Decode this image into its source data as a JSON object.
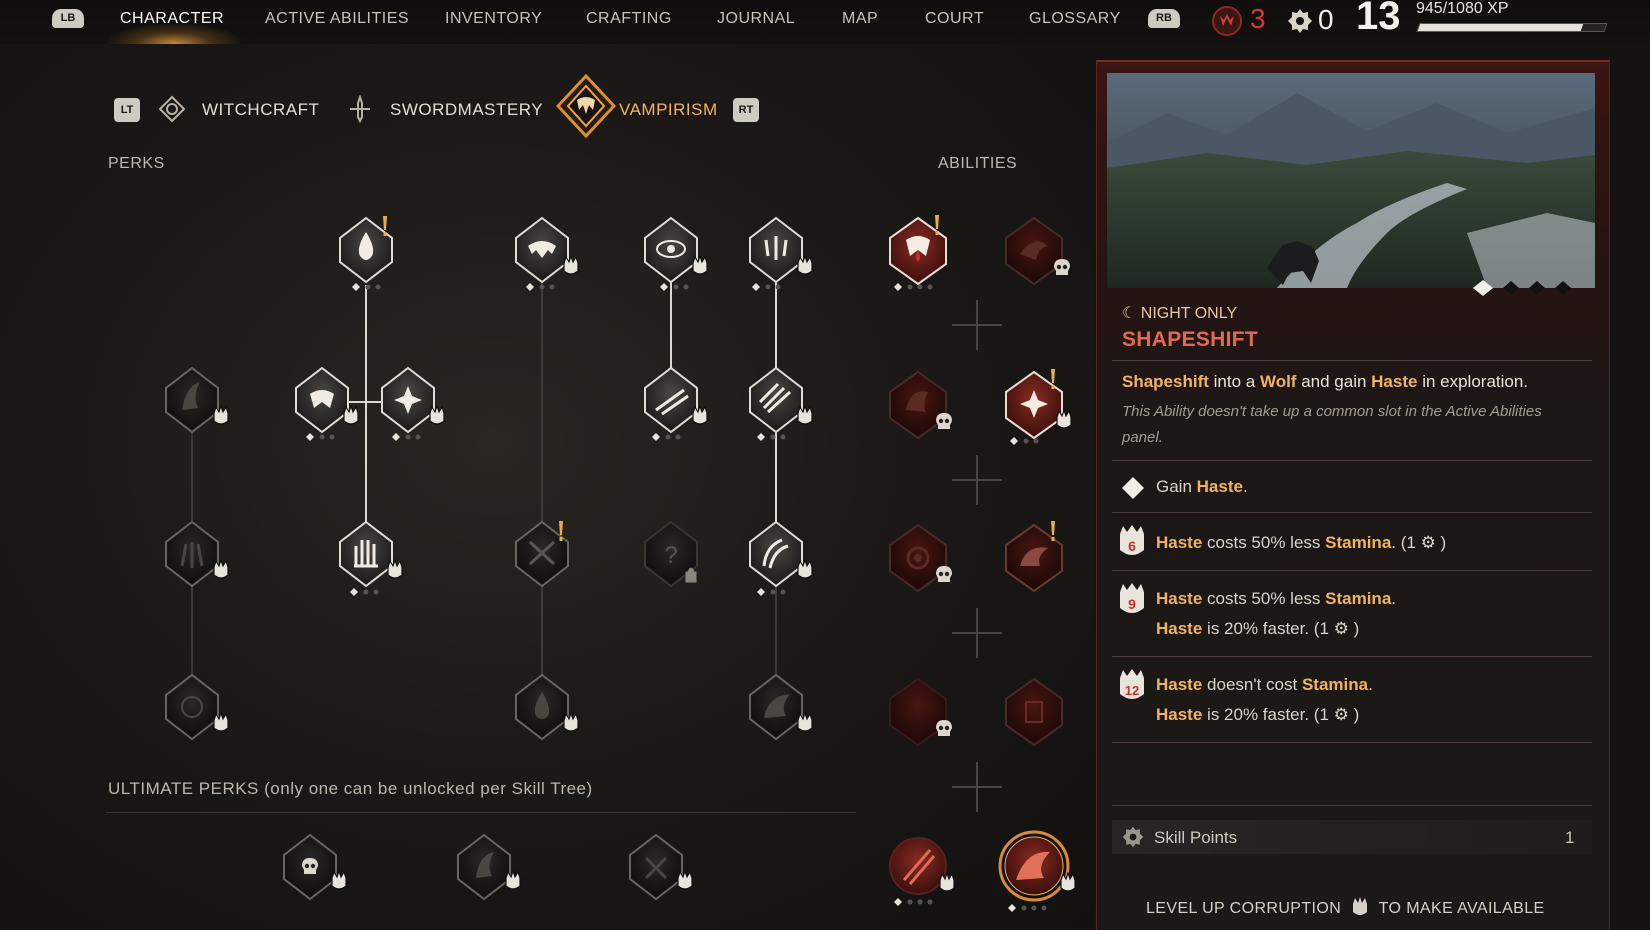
{
  "nav": {
    "lb": "LB",
    "rb": "RB",
    "tabs": [
      "CHARACTER",
      "ACTIVE ABILITIES",
      "INVENTORY",
      "CRAFTING",
      "JOURNAL",
      "MAP",
      "COURT",
      "GLOSSARY"
    ],
    "active_tab": "CHARACTER"
  },
  "stats": {
    "corruption_points": "3",
    "skill_points": "0",
    "level": "13",
    "xp_text": "945/1080 XP",
    "xp_progress": 0.875
  },
  "skill_trees": {
    "lt": "LT",
    "rt": "RT",
    "tabs": [
      "WITCHCRAFT",
      "SWORDMASTERY",
      "VAMPIRISM"
    ],
    "active": "VAMPIRISM"
  },
  "sections": {
    "perks": "PERKS",
    "abilities": "ABILITIES",
    "ultimate": "ULTIMATE PERKS (only one can be unlocked per Skill Tree)"
  },
  "detail": {
    "tag": "☾ NIGHT ONLY",
    "title": "SHAPESHIFT",
    "desc_parts": [
      "Shapeshift",
      " into a ",
      "Wolf",
      " and gain ",
      "Haste",
      " in exploration."
    ],
    "note": "This Ability doesn't take up a common slot in the Active Abilities panel.",
    "base": [
      "Gain ",
      "Haste",
      "."
    ],
    "upgrades": [
      {
        "rank": "6",
        "l1": [
          "Haste",
          " costs 50% less ",
          "Stamina",
          ".  (1 ⚙ )"
        ],
        "l2": []
      },
      {
        "rank": "9",
        "l1": [
          "Haste",
          " costs 50% less ",
          "Stamina",
          "."
        ],
        "l2": [
          "Haste",
          " is 20% faster.  (1 ⚙ )"
        ]
      },
      {
        "rank": "12",
        "l1": [
          "Haste",
          " doesn't cost ",
          "Stamina",
          "."
        ],
        "l2": [
          "Haste",
          " is 20% faster.  (1 ⚙ )"
        ]
      }
    ],
    "skill_points_label": "Skill Points",
    "skill_points_value": "1",
    "footer_a": "LEVEL UP CORRUPTION",
    "footer_b": "TO MAKE AVAILABLE"
  },
  "colors": {
    "accent_gold": "#f0b45a",
    "title_red": "#e46a4f",
    "corruption_red": "#d9352a"
  }
}
